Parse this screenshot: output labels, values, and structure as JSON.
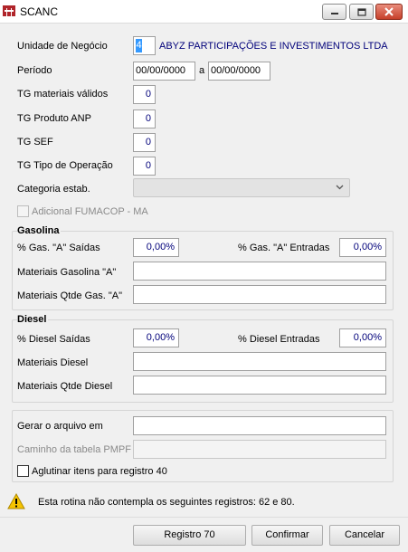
{
  "window": {
    "title": "SCANC"
  },
  "form": {
    "unidade_label": "Unidade de Negócio",
    "unidade_code": "4",
    "unidade_name": "ABYZ PARTICIPAÇÕES E INVESTIMENTOS LTDA",
    "periodo_label": "Período",
    "periodo_from": "00/00/0000",
    "periodo_sep": "a",
    "periodo_to": "00/00/0000",
    "tg_materiais_label": "TG materiais válidos",
    "tg_materiais_value": "0",
    "tg_produto_label": "TG Produto ANP",
    "tg_produto_value": "0",
    "tg_sef_label": "TG SEF",
    "tg_sef_value": "0",
    "tg_tipo_label": "TG Tipo de Operação",
    "tg_tipo_value": "0",
    "categoria_label": "Categoria estab.",
    "categoria_value": "",
    "adicional_label": "Adicional FUMACOP - MA"
  },
  "gasolina": {
    "title": "Gasolina",
    "saidas_label": "% Gas. \"A\" Saídas",
    "saidas_value": "0,00%",
    "entradas_label": "% Gas. \"A\" Entradas",
    "entradas_value": "0,00%",
    "materiais_label": "Materiais Gasolina \"A\"",
    "materiais_value": "",
    "qtde_label": "Materiais Qtde Gas. \"A\"",
    "qtde_value": ""
  },
  "diesel": {
    "title": "Diesel",
    "saidas_label": "% Diesel Saídas",
    "saidas_value": "0,00%",
    "entradas_label": "% Diesel Entradas",
    "entradas_value": "0,00%",
    "materiais_label": "Materiais Diesel",
    "materiais_value": "",
    "qtde_label": "Materiais Qtde Diesel",
    "qtde_value": ""
  },
  "arquivo": {
    "gerar_label": "Gerar o arquivo em",
    "gerar_value": "",
    "caminho_label": "Caminho da tabela PMPF",
    "caminho_value": "",
    "aglutinar_label": "Aglutinar itens para registro 40"
  },
  "warning": {
    "text": "Esta rotina não contempla os seguintes registros: 62 e 80."
  },
  "buttons": {
    "registro70": "Registro 70",
    "confirmar": "Confirmar",
    "cancelar": "Cancelar"
  },
  "icons": {
    "app": "app-icon",
    "warning": "warning-icon",
    "dropdown": "chevron-down-icon"
  },
  "colors": {
    "value_text": "#00007a",
    "close_button": "#c6402a",
    "selection": "#3399ff",
    "warning": "#f5c400"
  }
}
